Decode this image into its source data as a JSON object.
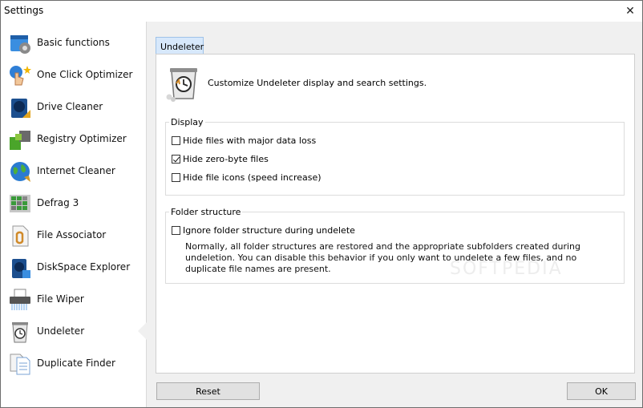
{
  "window": {
    "title": "Settings"
  },
  "sidebar": {
    "items": [
      {
        "label": "Basic functions",
        "icon": "basic-functions-icon"
      },
      {
        "label": "One Click Optimizer",
        "icon": "one-click-optimizer-icon"
      },
      {
        "label": "Drive Cleaner",
        "icon": "drive-cleaner-icon"
      },
      {
        "label": "Registry Optimizer",
        "icon": "registry-optimizer-icon"
      },
      {
        "label": "Internet Cleaner",
        "icon": "internet-cleaner-icon"
      },
      {
        "label": "Defrag 3",
        "icon": "defrag-icon"
      },
      {
        "label": "File Associator",
        "icon": "file-associator-icon"
      },
      {
        "label": "DiskSpace Explorer",
        "icon": "diskspace-explorer-icon"
      },
      {
        "label": "File Wiper",
        "icon": "file-wiper-icon"
      },
      {
        "label": "Undeleter",
        "icon": "undeleter-icon",
        "selected": true
      },
      {
        "label": "Duplicate Finder",
        "icon": "duplicate-finder-icon"
      }
    ]
  },
  "tab": {
    "label": "Undeleter"
  },
  "header": {
    "text": "Customize Undeleter display and search settings."
  },
  "display_group": {
    "title": "Display",
    "options": [
      {
        "label": "Hide files with major data loss",
        "checked": false
      },
      {
        "label": "Hide zero-byte files",
        "checked": true
      },
      {
        "label": "Hide file icons (speed increase)",
        "checked": false
      }
    ]
  },
  "folder_group": {
    "title": "Folder structure",
    "option": {
      "label": "Ignore folder structure during undelete",
      "checked": false
    },
    "note": "Normally, all folder structures are restored and the appropriate subfolders created during undeletion. You can disable this behavior if you only want to undelete a few files, and no duplicate file names are present."
  },
  "watermark": "SOFTPEDIA",
  "buttons": {
    "reset": "Reset",
    "ok": "OK"
  },
  "colors": {
    "tab_bg": "#d7e8fb",
    "tab_border": "#9fc2e8",
    "window_bg": "#f0f0f0"
  }
}
